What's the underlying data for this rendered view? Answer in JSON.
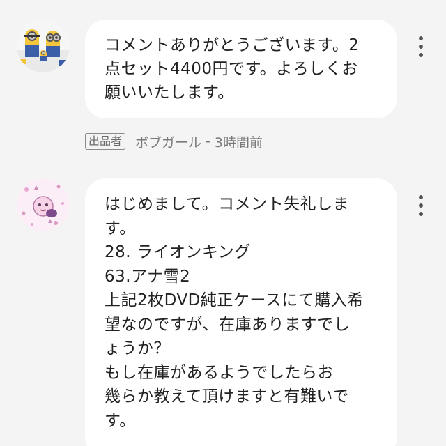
{
  "comments": [
    {
      "avatar": "minion-avatar",
      "text": "コメントありがとうございます。2\n点セット4400円です。よろしくお\n願いいたします。",
      "badge": "出品者",
      "author": "ボブガール",
      "time": "3時間前"
    },
    {
      "avatar": "character-avatar",
      "text": "はじめまして。コメント失礼しま\nす。\n28. ライオンキング\n63.アナ雪2\n上記2枚DVD純正ケースにて購入希\n望なのですが、在庫ありますでし\nょうか？\nもし在庫があるようでしたらお\n幾らか教えて頂けますと有難いで\nす。"
    }
  ],
  "colors": {
    "background": "#f4f4f4",
    "bubble": "#ffffff",
    "meta_text": "#7a7a7a"
  },
  "icons": {
    "more": "more-vert-icon"
  },
  "separator": "-"
}
